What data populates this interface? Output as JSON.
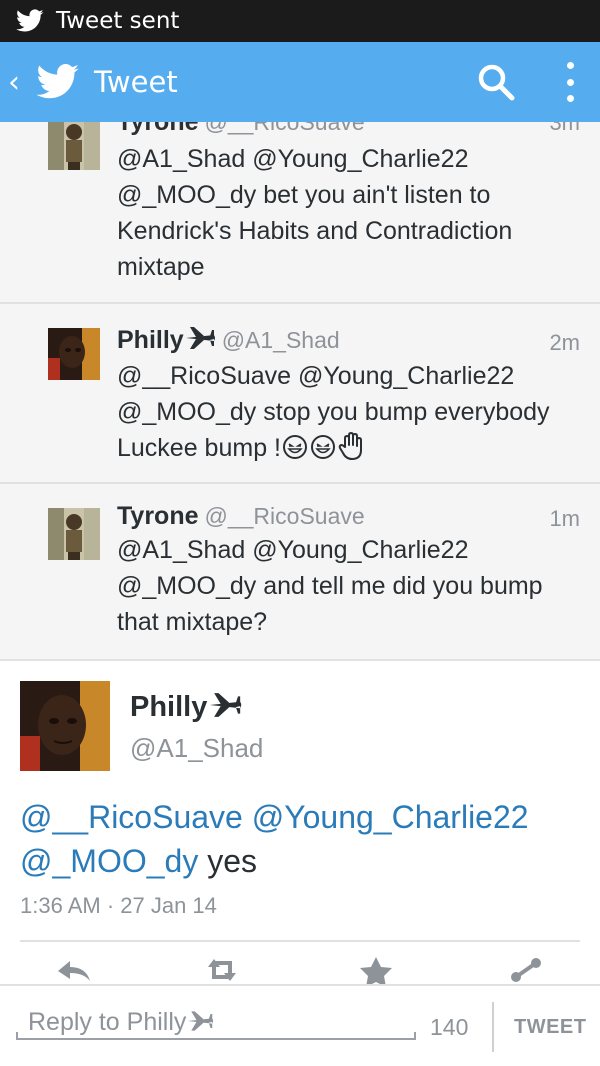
{
  "status_bar": {
    "notification": "Tweet sent"
  },
  "action_bar": {
    "back_glyph": "‹",
    "title": "Tweet",
    "icons": [
      "twitter-bird-icon",
      "search-icon",
      "overflow-menu-icon"
    ]
  },
  "replies": [
    {
      "name": "Tyrone",
      "handle": "@__RicoSuave",
      "time": "3m",
      "text": "@A1_Shad @Young_Charlie22 @_MOO_dy bet you ain't listen to Kendrick's Habits and  Contradiction mixtape"
    },
    {
      "name": "Philly",
      "handle": "@A1_Shad",
      "time": "2m",
      "text_line1": "@__RicoSuave @Young_Charlie22",
      "text_line2": "@_MOO_dy stop you bump everybody",
      "text_line3": "Luckee bump !"
    },
    {
      "name": "Tyrone",
      "handle": "@__RicoSuave",
      "time": "1m",
      "text": "@A1_Shad @Young_Charlie22 @_MOO_dy and tell me did you bump that mixtape?"
    }
  ],
  "main_tweet": {
    "name": "Philly",
    "handle": "@A1_Shad",
    "mention1": "@__RicoSuave",
    "mention2": "@Young_Charlie22",
    "mention3": "@_MOO_dy",
    "text_rest": " yes",
    "timestamp": "1:36 AM · 27 Jan 14",
    "actions": [
      "reply-icon",
      "retweet-icon",
      "favorite-icon",
      "share-icon"
    ]
  },
  "reply_bar": {
    "placeholder": "Reply to Philly",
    "char_count": "140",
    "send_label": "TWEET"
  },
  "colors": {
    "brand": "#55acee",
    "link": "#2b7bb9",
    "muted": "#8e9399",
    "text": "#292f33"
  }
}
